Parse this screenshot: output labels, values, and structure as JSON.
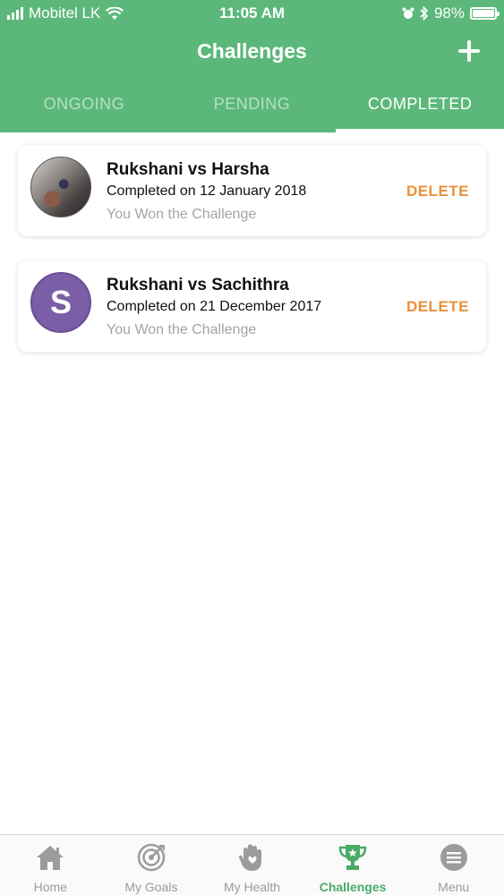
{
  "status_bar": {
    "carrier": "Mobitel LK",
    "time": "11:05 AM",
    "battery": "98%"
  },
  "header": {
    "title": "Challenges",
    "add_icon": "plus-icon"
  },
  "tabs": [
    {
      "label": "ONGOING",
      "active": false
    },
    {
      "label": "PENDING",
      "active": false
    },
    {
      "label": "COMPLETED",
      "active": true
    }
  ],
  "challenges": [
    {
      "title": "Rukshani vs Harsha",
      "date": "Completed on 12 January 2018",
      "result": "You Won the Challenge",
      "avatar": "photo",
      "delete_label": "DELETE"
    },
    {
      "title": "Rukshani vs Sachithra",
      "date": "Completed on 21 December 2017",
      "result": "You Won the Challenge",
      "avatar": "letter",
      "avatar_letter": "S",
      "delete_label": "DELETE"
    }
  ],
  "bottom_nav": [
    {
      "label": "Home",
      "icon": "home-icon"
    },
    {
      "label": "My Goals",
      "icon": "target-icon"
    },
    {
      "label": "My Health",
      "icon": "hand-heart-icon"
    },
    {
      "label": "Challenges",
      "icon": "trophy-icon",
      "active": true
    },
    {
      "label": "Menu",
      "icon": "menu-icon"
    }
  ],
  "colors": {
    "primary": "#5cb87a",
    "accent": "#e8913a",
    "avatar_purple": "#7b5ea5"
  }
}
